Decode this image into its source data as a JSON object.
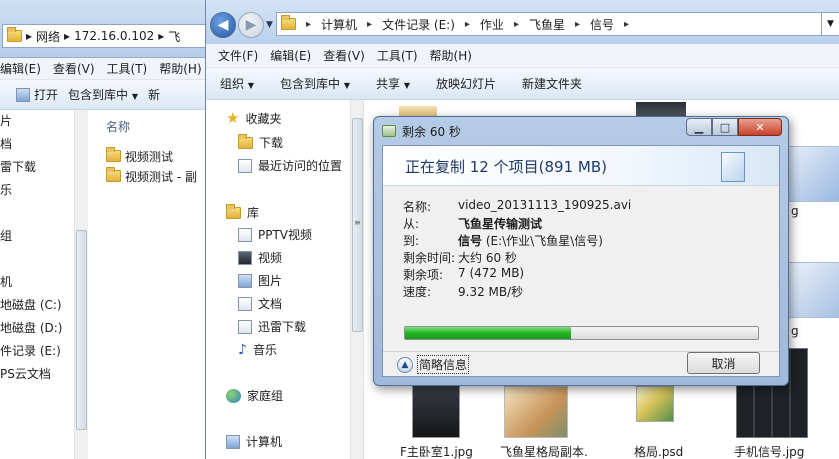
{
  "back_window": {
    "address": {
      "segments": [
        "网络",
        "172.16.0.102",
        "飞"
      ]
    },
    "menu": [
      "编辑(E)",
      "查看(V)",
      "工具(T)",
      "帮助(H)"
    ],
    "toolbar": {
      "open": "打开",
      "include": "包含到库中",
      "more": "新"
    },
    "nav_items": [
      "片",
      "档",
      "雷下载",
      "乐",
      "",
      "组",
      "",
      "机",
      "地磁盘 (C:)",
      "地磁盘 (D:)",
      "件记录 (E:)",
      "PS云文档"
    ],
    "column_header": "名称",
    "files": [
      "视频测试",
      "视频测试 - 副"
    ]
  },
  "front_window": {
    "address": {
      "segments": [
        "计算机",
        "文件记录 (E:)",
        "作业",
        "飞鱼星",
        "信号"
      ]
    },
    "menu": [
      "文件(F)",
      "编辑(E)",
      "查看(V)",
      "工具(T)",
      "帮助(H)"
    ],
    "toolbar": {
      "organize": "组织",
      "include": "包含到库中",
      "share": "共享",
      "slideshow": "放映幻灯片",
      "new_folder": "新建文件夹"
    },
    "nav": {
      "favorites": "收藏夹",
      "downloads": "下载",
      "recent": "最近访问的位置",
      "libraries": "库",
      "pptv": "PPTV视频",
      "videos": "视频",
      "pictures": "图片",
      "documents": "文档",
      "xunlei": "迅雷下载",
      "music": "音乐",
      "homegroup": "家庭组",
      "computer": "计算机"
    },
    "files": [
      "F主卧室1.jpg",
      "飞鱼星格局副本.",
      "格局.psd",
      "手机信号.jpg"
    ],
    "partial_labels": [
      "g",
      "g"
    ]
  },
  "copy_dialog": {
    "title": "剩余 60 秒",
    "heading": "正在复制 12 个项目(891 MB)",
    "rows": [
      {
        "key": "名称:",
        "value": "video_20131113_190925.avi",
        "bold": false
      },
      {
        "key": "从:",
        "value": "飞鱼星传输测试",
        "bold": true
      },
      {
        "key": "到:",
        "value_bold": "信号",
        "value_rest": " (E:\\作业\\飞鱼星\\信号)"
      },
      {
        "key": "剩余时间:",
        "value": "大约 60 秒",
        "bold": false
      },
      {
        "key": "剩余项:",
        "value": "7 (472 MB)",
        "bold": false
      },
      {
        "key": "速度:",
        "value": "9.32 MB/秒",
        "bold": false
      }
    ],
    "progress_fraction": 0.47,
    "less_info": "简略信息",
    "cancel": "取消"
  },
  "colors": {
    "progress_green": "#25b325",
    "dialog_frame": "#a9c2e2",
    "heading_blue": "#1f3a6a"
  }
}
